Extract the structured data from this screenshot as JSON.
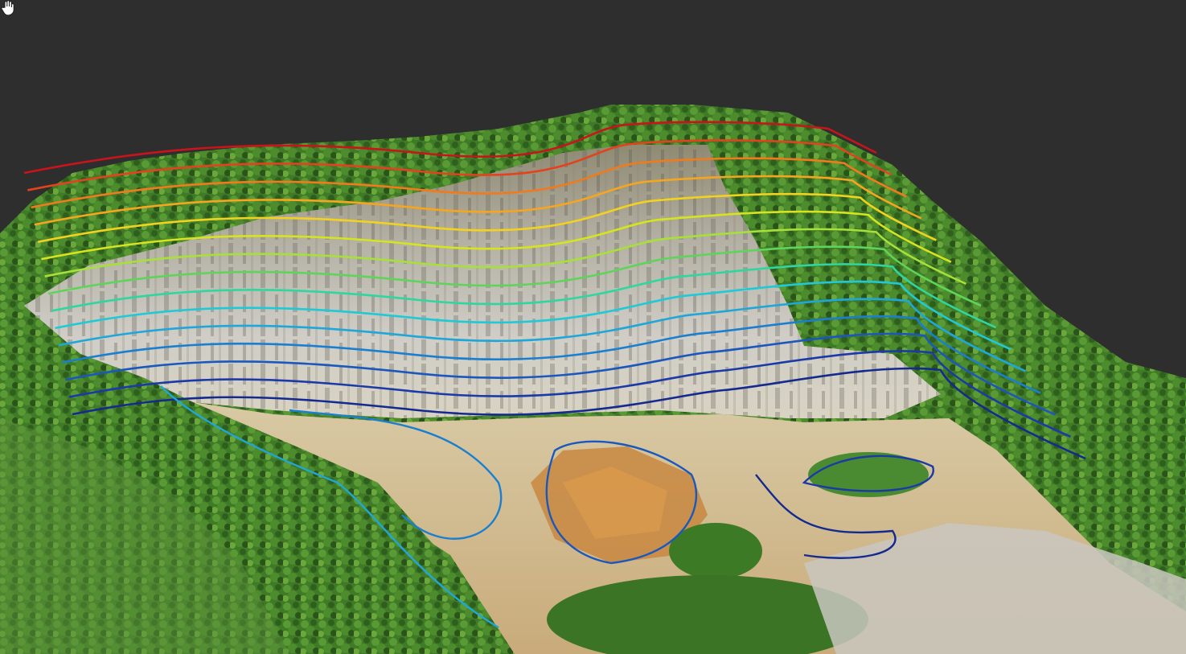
{
  "viewer": {
    "mode": "3d-point-cloud",
    "background_color": "#2f2e2e"
  },
  "cursor": {
    "icon": "hand-pan-icon"
  },
  "contours": {
    "color_scale": [
      "#c8141a",
      "#e3421c",
      "#f07a1c",
      "#f5a51e",
      "#f2d21e",
      "#d6e41f",
      "#a8e03a",
      "#5fd45a",
      "#2fd6a0",
      "#1fc9d6",
      "#1ea7d8",
      "#1b7fd0",
      "#1a58bd",
      "#1a3aa8",
      "#152a8f"
    ],
    "level_count": 15
  }
}
